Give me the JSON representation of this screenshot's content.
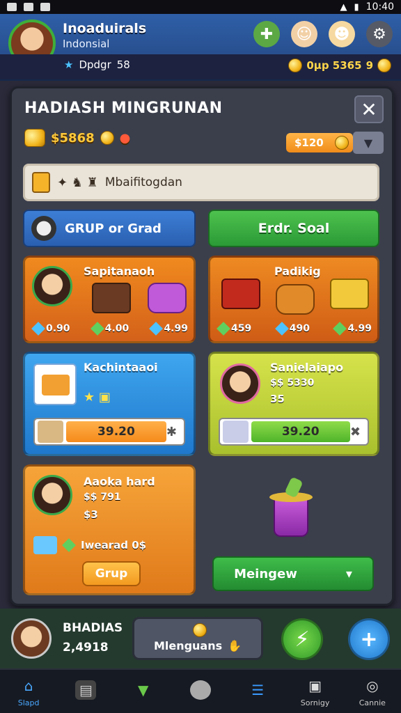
{
  "status": {
    "time": "10:40"
  },
  "player": {
    "name": "Inoaduirals",
    "subtitle": "Indonsial",
    "rank": "Dpdgr",
    "rank_value": "58",
    "coins": "0µp 5365",
    "extra": "9"
  },
  "panel": {
    "title": "HADIASH MINGRUNAN",
    "balance": "$5868",
    "price": "$120",
    "search_text": "Mbaifitogdan",
    "tab_group_label": "GRUP or Grad",
    "tab_soal_label": "Erdr. Soal",
    "cards": [
      {
        "title": "Sapitanaoh",
        "stats": [
          "0.90",
          "4.00",
          "4.99"
        ]
      },
      {
        "title": "Padikig",
        "stats": [
          "459",
          "490",
          "4.99"
        ]
      },
      {
        "title": "Kachintaaoi",
        "bar_value": "39.20"
      },
      {
        "title": "Sanielaiapo",
        "line1": "$$ 5330",
        "line2": "35",
        "bar_value": "39.20"
      },
      {
        "title": "Aaoka hard",
        "line1": "$$ 791",
        "line2": "$3",
        "reward": "Iwearad 0$",
        "button": "Grup"
      }
    ],
    "action_button": "Meingew"
  },
  "lower": {
    "name": "BHADIAS",
    "score": "2,4918",
    "center_label": "Mlenguans"
  },
  "nav": [
    {
      "label": "Slapd",
      "icon": "home-icon"
    },
    {
      "label": "",
      "icon": "chart-icon"
    },
    {
      "label": "",
      "icon": "bucket-icon"
    },
    {
      "label": "",
      "icon": "circle-icon"
    },
    {
      "label": "",
      "icon": "database-icon"
    },
    {
      "label": "Sornigy",
      "icon": "chest-icon"
    },
    {
      "label": "Cannie",
      "icon": "target-icon"
    }
  ],
  "colors": {
    "accent_green": "#2a9a36",
    "accent_blue": "#2a5fb0",
    "gold": "#ffc93a"
  }
}
